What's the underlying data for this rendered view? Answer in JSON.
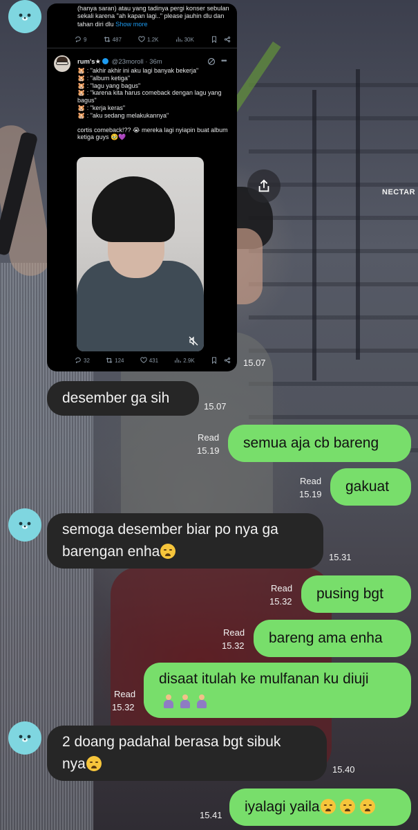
{
  "tweet": {
    "prev_text": "(hanya saran) atau yang tadinya pergi konser sebulan sekali karena \"ah kapan lagi..\" please jauhin dlu dan tahan diri dlu",
    "prev_show_more": "Show more",
    "prev_stats": {
      "replies": "9",
      "reposts": "487",
      "likes": "1.2K",
      "views": "30K"
    },
    "author_name": "rum's",
    "author_star": "★",
    "author_handle": "@23moroll",
    "author_time": "· 36m",
    "lines": [
      "🐹 : \"akhir akhir ini aku lagi banyak bekerja\"",
      "🐹 : \"album ketiga\"",
      "🐹 : \"lagu yang bagus\"",
      "🐹 : \"karena kita harus comeback dengan lagu yang bagus\"",
      "🐹 : \"kerja keras\"",
      "🐹 : \"aku sedang melakukannya\""
    ],
    "closing": "cortis comeback!?? 😭 mereka lagi nyiapin buat album ketiga guys 🥹💜",
    "stats": {
      "replies": "32",
      "reposts": "124",
      "likes": "431",
      "views": "2.9K"
    },
    "bubble_time": "15.07"
  },
  "background": {
    "watermark": "NECTAR"
  },
  "messages": [
    {
      "dir": "in",
      "text": "desember ga sih",
      "time": "15.07",
      "read": ""
    },
    {
      "dir": "out",
      "text": "semua aja cb bareng",
      "time": "15.19",
      "read": "Read"
    },
    {
      "dir": "out",
      "text": "gakuat",
      "time": "15.19",
      "read": "Read"
    },
    {
      "dir": "in",
      "text1": "semoga desember biar po nya ga",
      "text2": "barengan enha",
      "time": "15.31",
      "read": ""
    },
    {
      "dir": "out",
      "text": "pusing bgt",
      "time": "15.32",
      "read": "Read"
    },
    {
      "dir": "out",
      "text": "bareng ama enha",
      "time": "15.32",
      "read": "Read"
    },
    {
      "dir": "out",
      "text": "disaat itulah ke mulfanan ku diuji",
      "time": "15.32",
      "read": "Read"
    },
    {
      "dir": "in",
      "text1": "2 doang padahal berasa bgt sibuk",
      "text2": "nya",
      "time": "15.40",
      "read": ""
    },
    {
      "dir": "out",
      "text": "iyalagi yaila",
      "time": "15.41",
      "read": ""
    }
  ],
  "colors": {
    "incoming": "#262626",
    "outgoing": "#78de6b",
    "avatar": "#7fd6e0",
    "link": "#1d9bf0"
  }
}
